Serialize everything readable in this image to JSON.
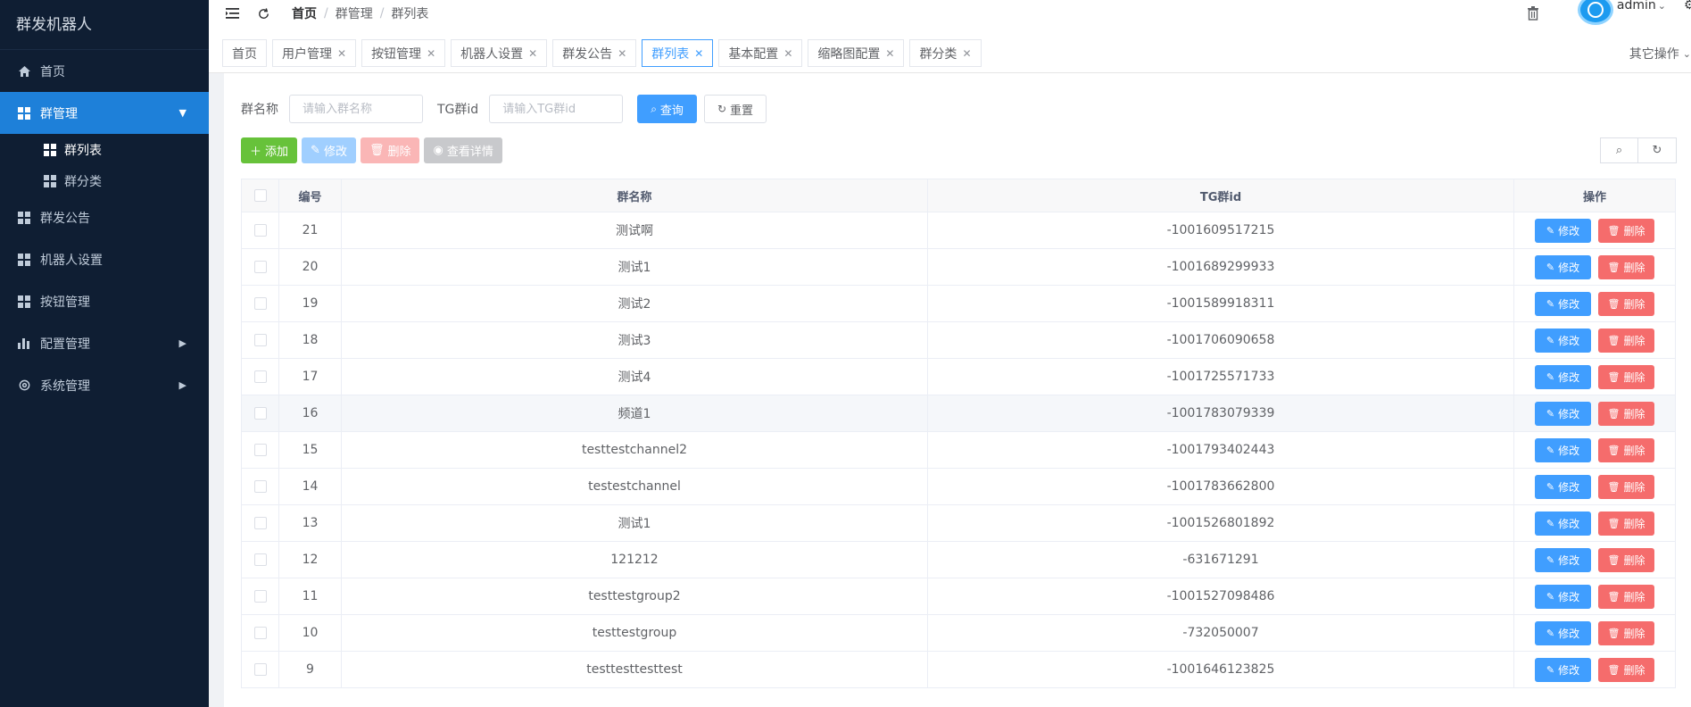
{
  "app": {
    "title": "群发机器人"
  },
  "sidebar": {
    "items": [
      {
        "label": "首页",
        "icon": "home-icon"
      },
      {
        "label": "群管理",
        "icon": "grid-icon",
        "expanded": true,
        "children": [
          {
            "label": "群列表"
          },
          {
            "label": "群分类"
          }
        ]
      },
      {
        "label": "群发公告",
        "icon": "grid-icon"
      },
      {
        "label": "机器人设置",
        "icon": "grid-icon"
      },
      {
        "label": "按钮管理",
        "icon": "grid-icon"
      },
      {
        "label": "配置管理",
        "icon": "chart-icon"
      },
      {
        "label": "系统管理",
        "icon": "gear-icon"
      }
    ]
  },
  "header": {
    "breadcrumb": [
      "首页",
      "群管理",
      "群列表"
    ],
    "user": "admin"
  },
  "tags": [
    "首页",
    "用户管理",
    "按钮管理",
    "机器人设置",
    "群发公告",
    "群列表",
    "基本配置",
    "缩略图配置",
    "群分类"
  ],
  "other_ops": "其它操作",
  "search": {
    "name_label": "群名称",
    "name_placeholder": "请输入群名称",
    "tgid_label": "TG群id",
    "tgid_placeholder": "请输入TG群id",
    "query_btn": "查询",
    "reset_btn": "重置"
  },
  "toolbar": {
    "add": "添加",
    "edit": "修改",
    "delete": "删除",
    "detail": "查看详情"
  },
  "table": {
    "columns": [
      "编号",
      "群名称",
      "TG群id",
      "操作"
    ],
    "edit_label": "修改",
    "delete_label": "删除",
    "rows": [
      {
        "id": "21",
        "name": "测试啊",
        "tgid": "-1001609517215"
      },
      {
        "id": "20",
        "name": "测试1",
        "tgid": "-1001689299933"
      },
      {
        "id": "19",
        "name": "测试2",
        "tgid": "-1001589918311"
      },
      {
        "id": "18",
        "name": "测试3",
        "tgid": "-1001706090658"
      },
      {
        "id": "17",
        "name": "测试4",
        "tgid": "-1001725571733"
      },
      {
        "id": "16",
        "name": "频道1",
        "tgid": "-1001783079339"
      },
      {
        "id": "15",
        "name": "testtestchannel2",
        "tgid": "-1001793402443"
      },
      {
        "id": "14",
        "name": "testestchannel",
        "tgid": "-1001783662800"
      },
      {
        "id": "13",
        "name": "测试1",
        "tgid": "-1001526801892"
      },
      {
        "id": "12",
        "name": "121212",
        "tgid": "-631671291"
      },
      {
        "id": "11",
        "name": "testtestgroup2",
        "tgid": "-1001527098486"
      },
      {
        "id": "10",
        "name": "testtestgroup",
        "tgid": "-732050007"
      },
      {
        "id": "9",
        "name": "testtesttesttest",
        "tgid": "-1001646123825"
      }
    ]
  },
  "colors": {
    "primary": "#409eff",
    "danger": "#f56c6c",
    "success": "#67c23a",
    "sidebar": "#0f1e33"
  }
}
